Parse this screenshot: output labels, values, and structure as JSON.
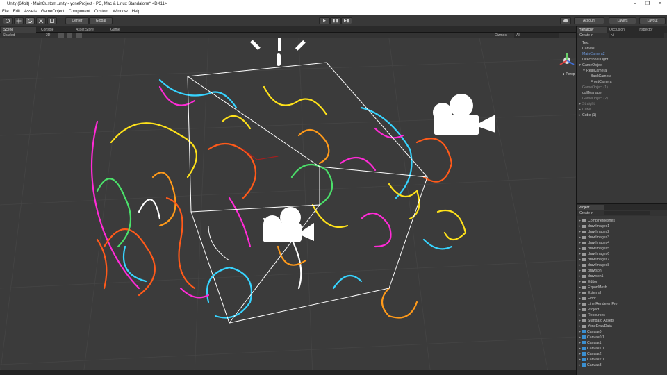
{
  "window": {
    "title": "Unity (64bit) - MainCustom.unity - yoneProject - PC, Mac & Linux Standalone* <DX11>",
    "min": "–",
    "max": "❐",
    "close": "✕"
  },
  "menu": [
    "File",
    "Edit",
    "Assets",
    "GameObject",
    "Component",
    "Custom",
    "Window",
    "Help"
  ],
  "toolbar": {
    "center": "Center",
    "global": "Global",
    "play": "▶",
    "pause": "❚❚",
    "step": "▶❚",
    "account": "Account",
    "layers": "Layers",
    "layout": "Layout"
  },
  "scene_tabs": [
    "Scene",
    "Console",
    "Asset Store",
    "Game"
  ],
  "scene_sub": {
    "shading": "Shaded",
    "mode": "2D",
    "gizmos": "Gizmos",
    "search": "All",
    "persp": "◄ Persp"
  },
  "hierarchy": {
    "tabs": [
      "Hierarchy",
      "Occlusion",
      "Inspector"
    ],
    "create": "Create ▾",
    "all": "All",
    "items": [
      {
        "label": "Text",
        "indent": 0,
        "arrow": "",
        "color": "#c8c8c8"
      },
      {
        "label": "Canvas",
        "indent": 0,
        "arrow": "",
        "color": "#c8c8c8"
      },
      {
        "label": "MainCamera2",
        "indent": 0,
        "arrow": "",
        "color": "#6f9be0"
      },
      {
        "label": "Directional Light",
        "indent": 0,
        "arrow": "",
        "color": "#c8c8c8"
      },
      {
        "label": "GameObject",
        "indent": 0,
        "arrow": "▼",
        "color": "#c8c8c8"
      },
      {
        "label": "RealCamera",
        "indent": 1,
        "arrow": "▼",
        "color": "#c8c8c8"
      },
      {
        "label": "BackCamera",
        "indent": 2,
        "arrow": "",
        "color": "#c8c8c8"
      },
      {
        "label": "FrontCamera",
        "indent": 2,
        "arrow": "",
        "color": "#c8c8c8"
      },
      {
        "label": "GameObject (1)",
        "indent": 0,
        "arrow": "",
        "color": "#8a8a8a"
      },
      {
        "label": "colliManager",
        "indent": 0,
        "arrow": "",
        "color": "#c8c8c8"
      },
      {
        "label": "GameObject (2)",
        "indent": 0,
        "arrow": "",
        "color": "#8a8a8a"
      },
      {
        "label": "Straight",
        "indent": 0,
        "arrow": "►",
        "color": "#8a8a8a"
      },
      {
        "label": "Cube",
        "indent": 0,
        "arrow": "►",
        "color": "#8a8a8a"
      },
      {
        "label": "Cube (1)",
        "indent": 0,
        "arrow": "►",
        "color": "#c8c8c8"
      }
    ]
  },
  "project": {
    "tab": "Project",
    "create": "Create ▾",
    "items": [
      {
        "label": "CombineMeshes",
        "type": "folder"
      },
      {
        "label": "drawImages1",
        "type": "folder"
      },
      {
        "label": "drawImages2",
        "type": "folder"
      },
      {
        "label": "drawImages3",
        "type": "folder"
      },
      {
        "label": "drawImages4",
        "type": "folder"
      },
      {
        "label": "drawImages5",
        "type": "folder"
      },
      {
        "label": "drawImages6",
        "type": "folder"
      },
      {
        "label": "drawImages7",
        "type": "folder"
      },
      {
        "label": "drawImages8",
        "type": "folder"
      },
      {
        "label": "drawsph",
        "type": "folder"
      },
      {
        "label": "drawsph1",
        "type": "folder"
      },
      {
        "label": "Editor",
        "type": "folder"
      },
      {
        "label": "ExportMesh",
        "type": "folder"
      },
      {
        "label": "External",
        "type": "folder"
      },
      {
        "label": "Floor",
        "type": "folder"
      },
      {
        "label": "Line Renderer Pro",
        "type": "folder"
      },
      {
        "label": "Project",
        "type": "folder"
      },
      {
        "label": "Resources",
        "type": "folder"
      },
      {
        "label": "Standard Assets",
        "type": "folder"
      },
      {
        "label": "YoneDrawData",
        "type": "folder"
      },
      {
        "label": "Canvas0",
        "type": "prefab"
      },
      {
        "label": "Canvas0 1",
        "type": "prefab"
      },
      {
        "label": "Canvas1",
        "type": "prefab"
      },
      {
        "label": "Canvas1 1",
        "type": "prefab"
      },
      {
        "label": "Canvas2",
        "type": "prefab"
      },
      {
        "label": "Canvas2 1",
        "type": "prefab"
      },
      {
        "label": "Canvas3",
        "type": "prefab"
      }
    ]
  },
  "icons": {
    "light": "sun-icon",
    "camera": "camera-icon",
    "gizmo": "axis-gizmo-icon"
  }
}
